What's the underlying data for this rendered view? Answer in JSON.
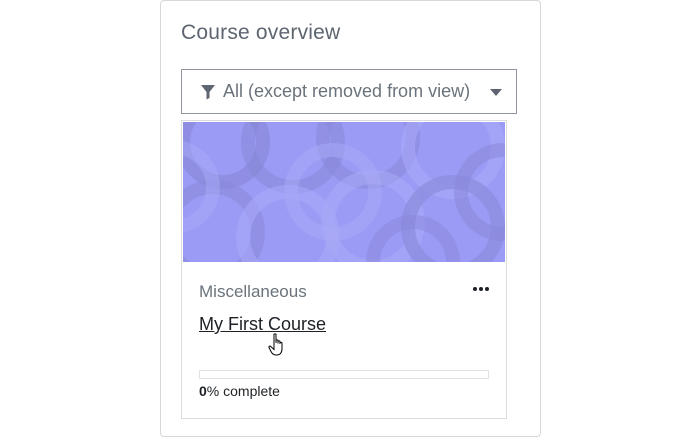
{
  "block": {
    "title": "Course overview",
    "filter": {
      "icon": "filter-funnel-icon",
      "label": "All (except removed from view)",
      "caret_icon": "caret-down-icon"
    }
  },
  "course_card": {
    "image_color": "#9b9bf5",
    "category": "Miscellaneous",
    "menu_icon": "ellipsis-icon",
    "course_name": "My First Course",
    "progress": {
      "percent_value": "0",
      "percent_suffix": "% complete",
      "fraction": 0
    }
  },
  "colors": {
    "link": "#1d2125",
    "muted": "#6a737b",
    "border": "#dadcde"
  }
}
